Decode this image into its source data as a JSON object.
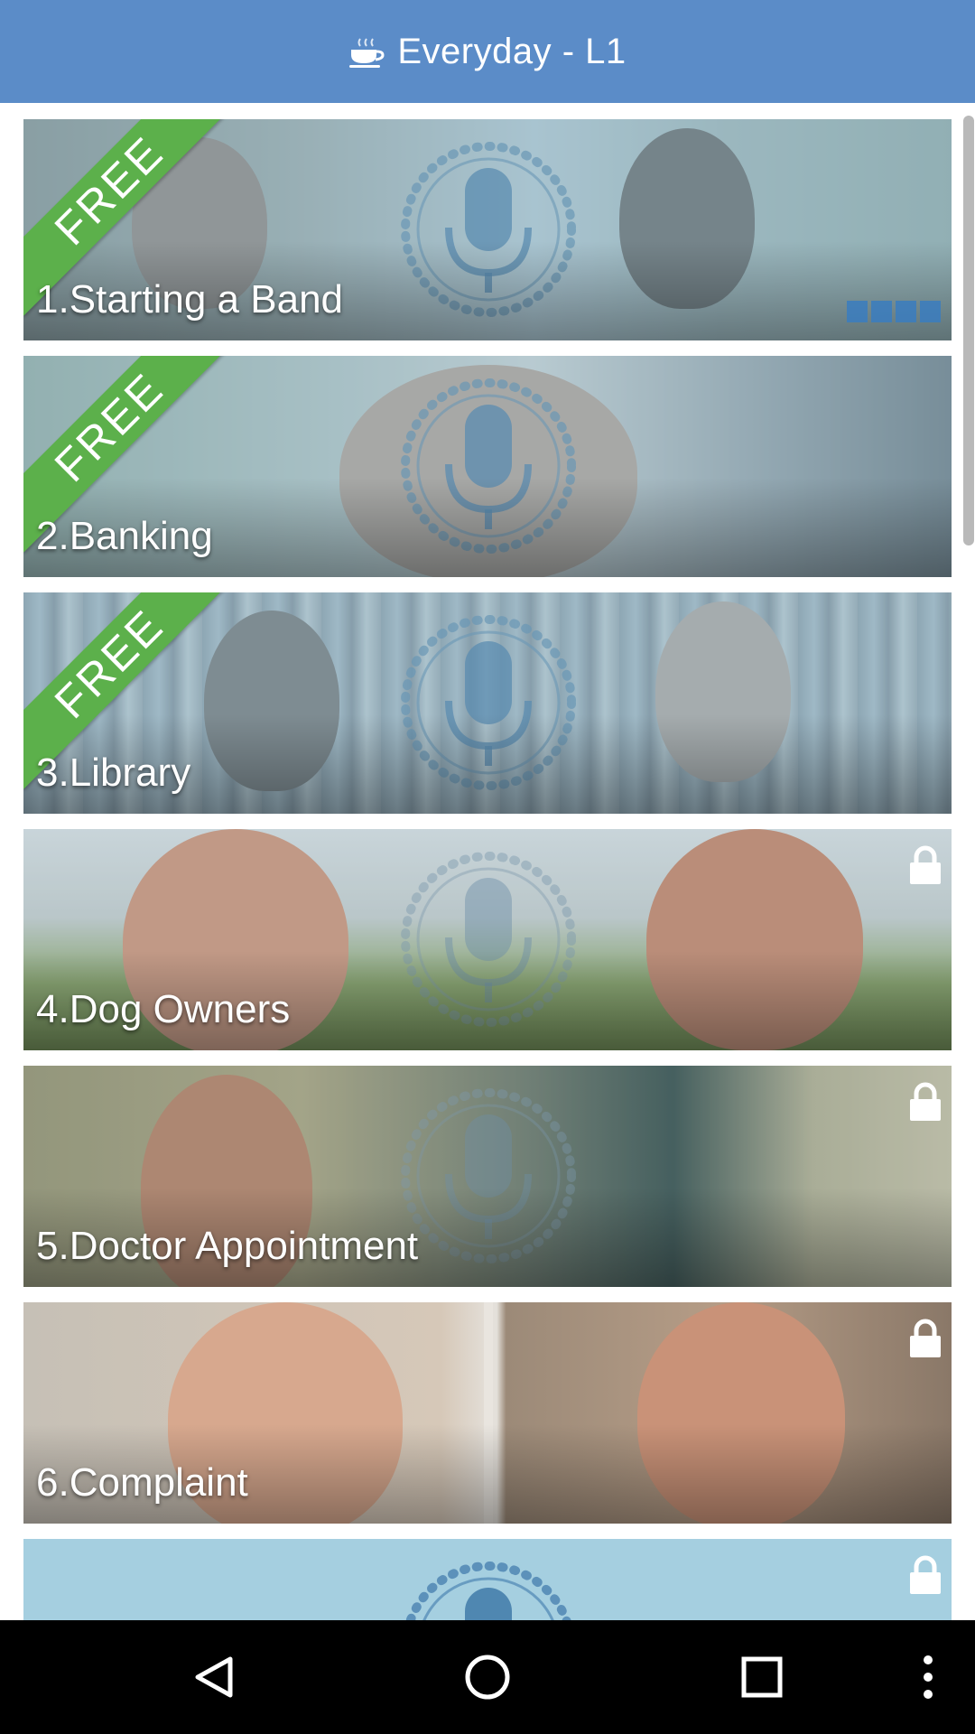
{
  "header": {
    "title": "Everyday - L1",
    "icon": "coffee-cup-icon",
    "background": "#5b8cc8"
  },
  "lessons": [
    {
      "label": "1.Starting a Band",
      "badge": "FREE",
      "locked": false,
      "progress_segments": 4
    },
    {
      "label": "2.Banking",
      "badge": "FREE",
      "locked": false
    },
    {
      "label": "3.Library",
      "badge": "FREE",
      "locked": false
    },
    {
      "label": "4.Dog Owners",
      "badge": "",
      "locked": true
    },
    {
      "label": "5.Doctor Appointment",
      "badge": "",
      "locked": true
    },
    {
      "label": "6.Complaint",
      "badge": "",
      "locked": true
    },
    {
      "label": "",
      "badge": "",
      "locked": true
    }
  ],
  "colors": {
    "free_ribbon": "#5cb04b",
    "progress": "#3a7cc0",
    "navbar": "#000000"
  },
  "navbar": {
    "icons": [
      "back-icon",
      "home-icon",
      "recents-icon",
      "overflow-menu-icon"
    ]
  }
}
